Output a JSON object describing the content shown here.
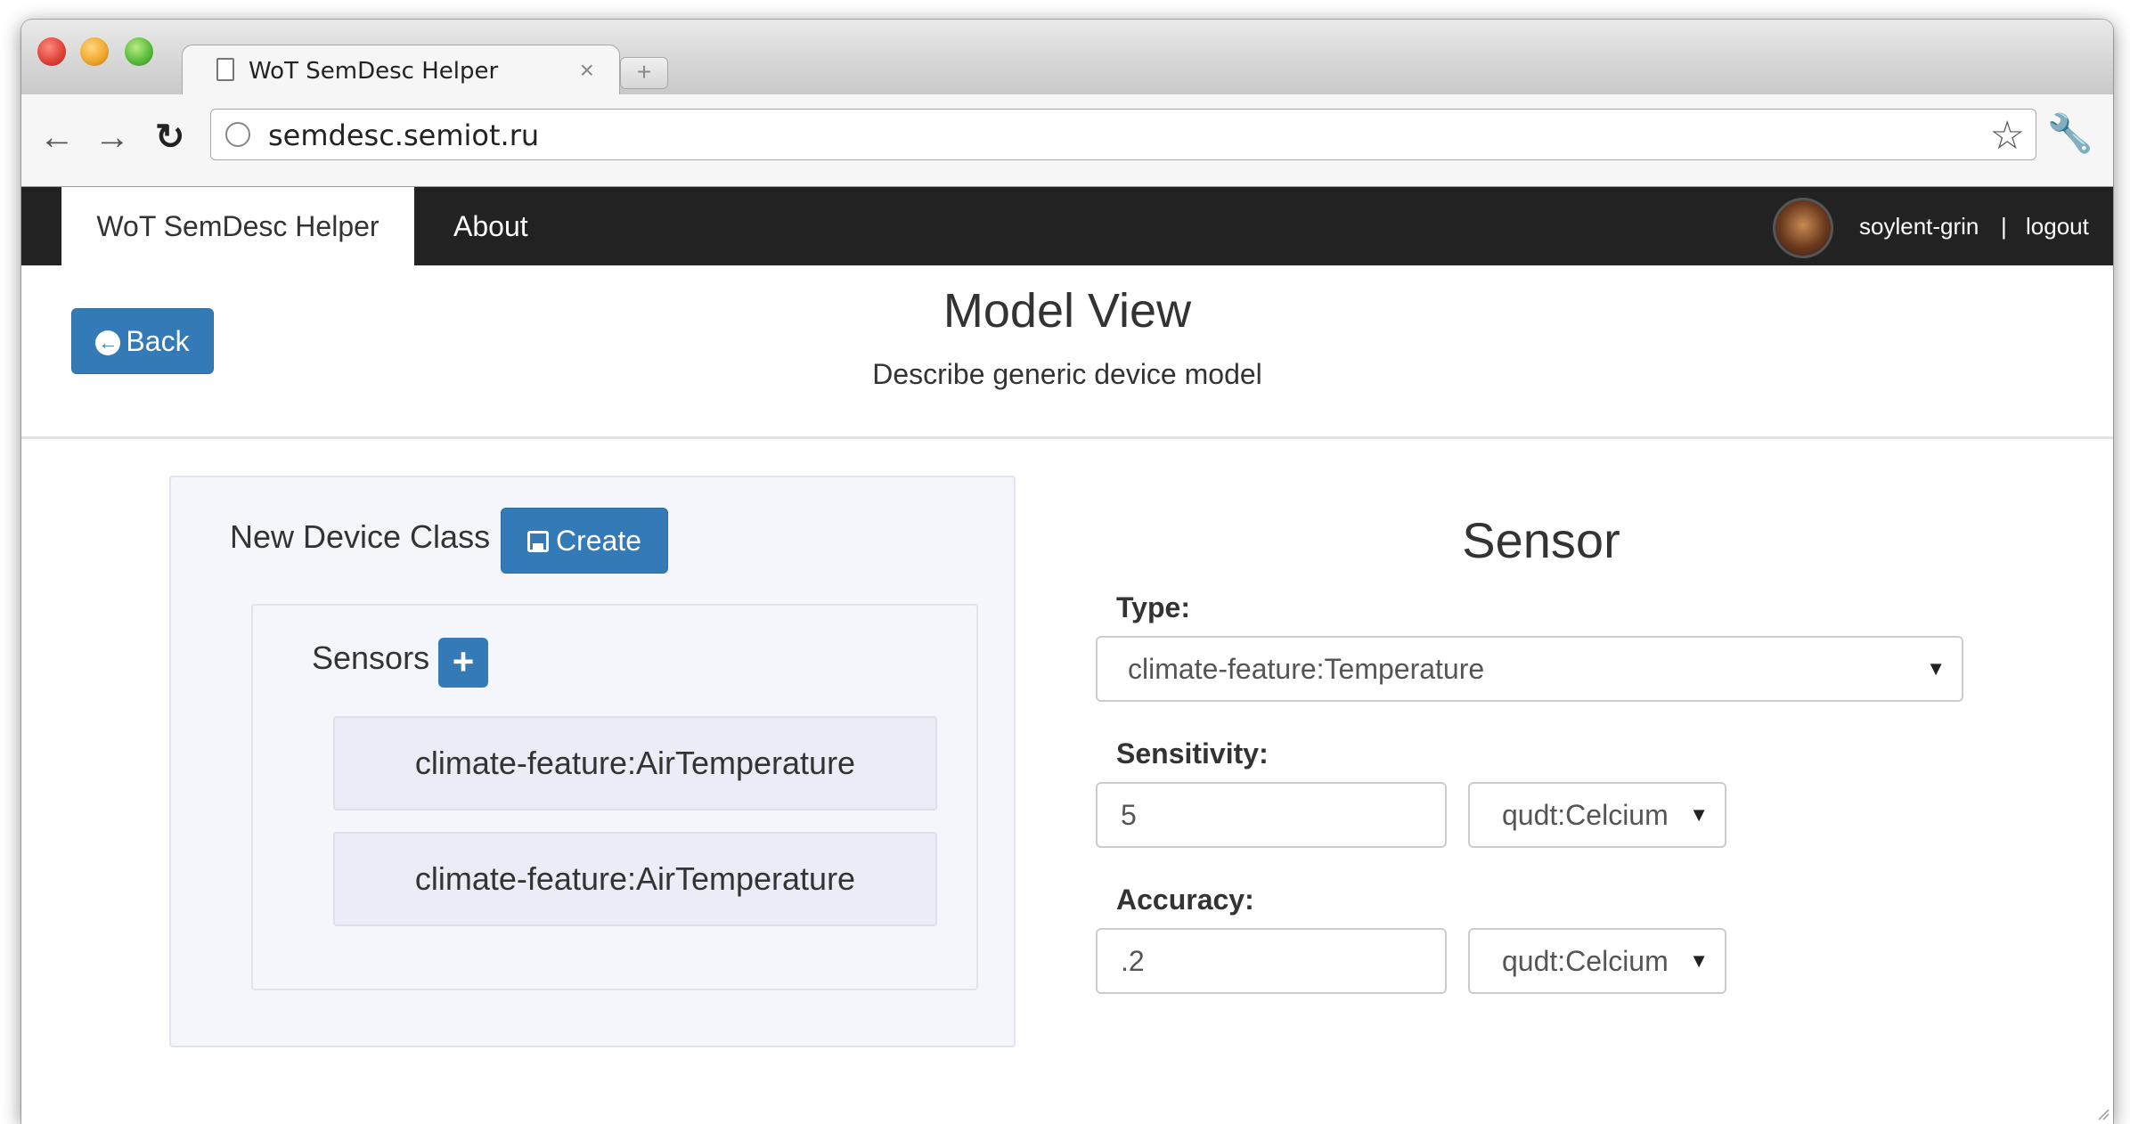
{
  "browser": {
    "tab_title": "WoT SemDesc Helper",
    "tab_close": "×",
    "new_tab": "+",
    "url": "semdesc.semiot.ru",
    "icons": {
      "back": "arrow-left-icon",
      "forward": "arrow-right-icon",
      "reload": "reload-icon",
      "star": "star-icon",
      "wrench": "wrench-icon",
      "globe": "globe-icon",
      "page": "page-icon"
    }
  },
  "navbar": {
    "brand": "WoT SemDesc Helper",
    "about": "About",
    "user": "soylent-grin",
    "separator": "|",
    "logout": "logout"
  },
  "header": {
    "back_label": "Back",
    "title": "Model View",
    "subtitle": "Describe generic device model"
  },
  "device": {
    "label": "New Device Class",
    "create_label": "Create",
    "sensors_label": "Sensors",
    "add_label": "+",
    "sensors": [
      {
        "name": "climate-feature:AirTemperature"
      },
      {
        "name": "climate-feature:AirTemperature"
      }
    ]
  },
  "sensor_form": {
    "title": "Sensor",
    "type_label": "Type:",
    "type_value": "climate-feature:Temperature",
    "sensitivity_label": "Sensitivity:",
    "sensitivity_value": "5",
    "sensitivity_unit": "qudt:Celcium",
    "accuracy_label": "Accuracy:",
    "accuracy_value": ".2",
    "accuracy_unit": "qudt:Celcium",
    "caret": "▼"
  },
  "colors": {
    "primary": "#337ab7",
    "navbar": "#222222",
    "panel": "#f5f5fc"
  }
}
